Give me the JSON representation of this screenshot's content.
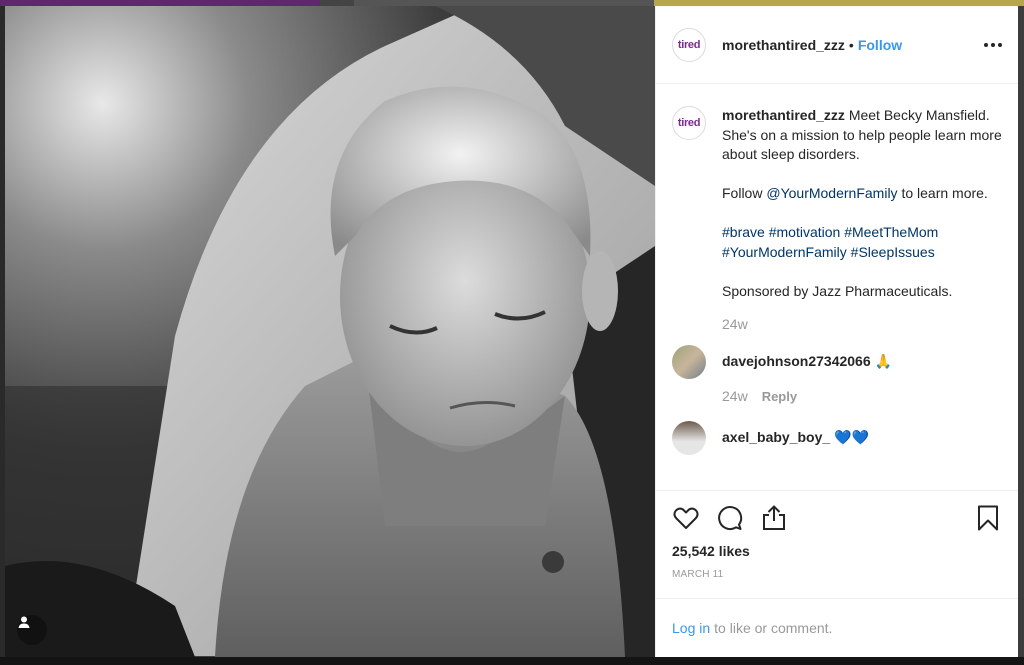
{
  "post": {
    "username": "morethantired_zzz",
    "header_separator": "•",
    "follow_label": "Follow",
    "logo_text": "tired",
    "caption": {
      "line1": "Meet Becky Mansfield. She's on a mission to help people learn more about sleep disorders.",
      "follow_prefix": "Follow ",
      "follow_mention": "@YourModernFamily",
      "follow_suffix": " to learn more.",
      "hashtags": [
        "#brave",
        "#motivation",
        "#MeetTheMom",
        "#YourModernFamily",
        "#SleepIssues"
      ],
      "sponsor": "Sponsored by Jazz Pharmaceuticals.",
      "age": "24w"
    },
    "comments": [
      {
        "username": "davejohnson27342066",
        "text": "🙏",
        "age": "24w",
        "reply_label": "Reply"
      },
      {
        "username": "axel_baby_boy_",
        "text": "💙💙"
      }
    ],
    "likes": "25,542 likes",
    "date": "MARCH 11",
    "login": {
      "link": "Log in",
      "rest": "to like or comment."
    }
  },
  "icons": {
    "like": "heart-icon",
    "comment": "comment-icon",
    "share": "share-icon",
    "save": "bookmark-icon",
    "more": "more-options-icon",
    "tag": "user-tag-icon"
  },
  "colors": {
    "link": "#003569",
    "follow": "#3897f0",
    "brand_purple": "#7a2b8c"
  }
}
